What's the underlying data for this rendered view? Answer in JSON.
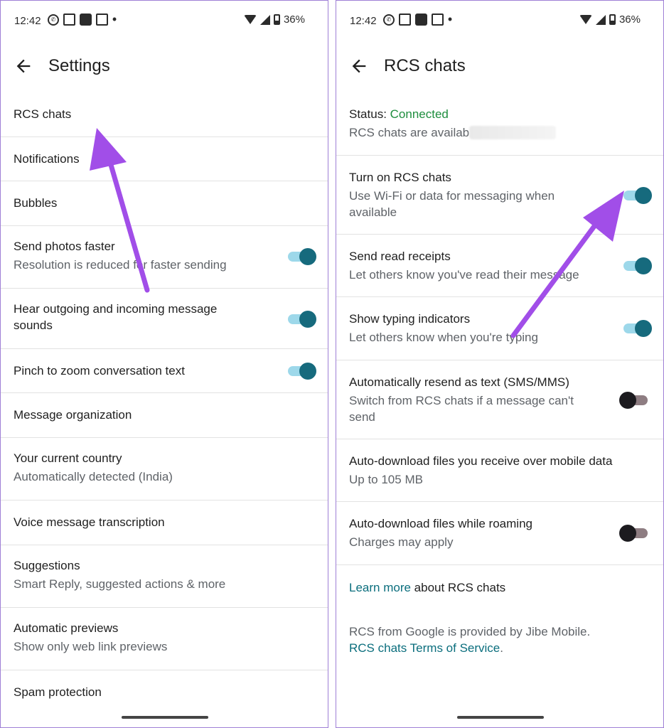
{
  "status_bar": {
    "time": "12:42",
    "battery": "36%"
  },
  "left": {
    "title": "Settings",
    "items": [
      {
        "title": "RCS chats"
      },
      {
        "title": "Notifications"
      },
      {
        "title": "Bubbles"
      },
      {
        "title": "Send photos faster",
        "subtitle": "Resolution is reduced for faster sending",
        "toggle": true
      },
      {
        "title": "Hear outgoing and incoming message sounds",
        "toggle": true
      },
      {
        "title": "Pinch to zoom conversation text",
        "toggle": true
      },
      {
        "title": "Message organization"
      },
      {
        "title": "Your current country",
        "subtitle": "Automatically detected (India)"
      },
      {
        "title": "Voice message transcription"
      },
      {
        "title": "Suggestions",
        "subtitle": "Smart Reply, suggested actions & more"
      },
      {
        "title": "Automatic previews",
        "subtitle": "Show only web link previews"
      },
      {
        "title": "Spam protection"
      }
    ]
  },
  "right": {
    "title": "RCS chats",
    "status_label": "Status: ",
    "status_value": "Connected",
    "status_detail": "RCS chats are availab",
    "items": [
      {
        "title": "Turn on RCS chats",
        "subtitle": "Use Wi-Fi or data for messaging when available",
        "toggle": true
      },
      {
        "title": "Send read receipts",
        "subtitle": "Let others know you've read their message",
        "toggle": true
      },
      {
        "title": "Show typing indicators",
        "subtitle": "Let others know when you're typing",
        "toggle": true
      },
      {
        "title": "Automatically resend as text (SMS/MMS)",
        "subtitle": "Switch from RCS chats if a message can't send",
        "toggle": false
      },
      {
        "title": "Auto-download files you receive over mobile data",
        "subtitle": "Up to 105 MB"
      },
      {
        "title": "Auto-download files while roaming",
        "subtitle": "Charges may apply",
        "toggle": false
      }
    ],
    "learn_more_link": "Learn more",
    "learn_more_rest": " about RCS chats",
    "footer_text": "RCS from Google is provided by Jibe Mobile.",
    "tos_link": "RCS chats Terms of Service",
    "tos_period": "."
  },
  "colors": {
    "accent": "#166a7d",
    "connected": "#1e8e3e",
    "arrow": "#a14ee8",
    "frame": "#9f7fd6"
  }
}
